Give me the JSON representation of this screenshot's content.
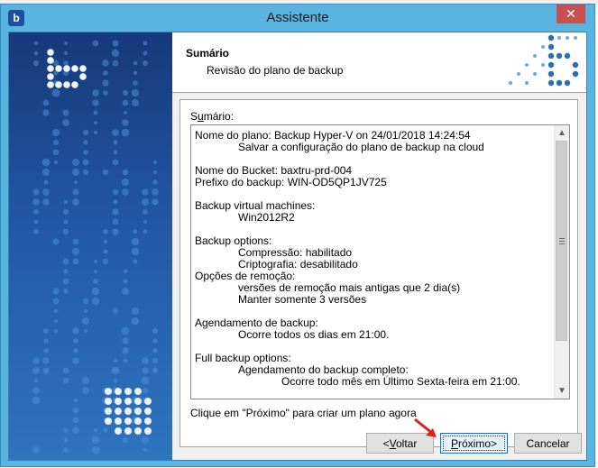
{
  "window": {
    "title": "Assistente",
    "icon": "app-logo-icon",
    "close_glyph": "✕"
  },
  "header": {
    "title": "Sumário",
    "subtitle": "Revisão do plano de backup"
  },
  "summary": {
    "label": "Sumário:",
    "lines": [
      {
        "text": "Nome do plano: Backup Hyper-V on 24/01/2018 14:24:54",
        "indent": 0
      },
      {
        "text": "Salvar a configuração do plano de backup na cloud",
        "indent": 1
      },
      {
        "text": "",
        "indent": 0
      },
      {
        "text": "Nome do Bucket: baxtru-prd-004",
        "indent": 0
      },
      {
        "text": "Prefixo do backup: WIN-OD5QP1JV725",
        "indent": 0
      },
      {
        "text": "",
        "indent": 0
      },
      {
        "text": "Backup virtual machines:",
        "indent": 0
      },
      {
        "text": "Win2012R2",
        "indent": 1
      },
      {
        "text": "",
        "indent": 0
      },
      {
        "text": "Backup options:",
        "indent": 0
      },
      {
        "text": "Compressão: habilitado",
        "indent": 1
      },
      {
        "text": "Criptografia: desabilitado",
        "indent": 1
      },
      {
        "text": "Opções de remoção:",
        "indent": 0
      },
      {
        "text": "versões de remoção mais antigas que 2 dia(s)",
        "indent": 1
      },
      {
        "text": "Manter somente 3 versões",
        "indent": 1
      },
      {
        "text": "",
        "indent": 0
      },
      {
        "text": "Agendamento de backup:",
        "indent": 0
      },
      {
        "text": "Ocorre todos os dias em 21:00.",
        "indent": 1
      },
      {
        "text": "",
        "indent": 0
      },
      {
        "text": "Full backup options:",
        "indent": 0
      },
      {
        "text": "Agendamento do backup completo:",
        "indent": 1
      },
      {
        "text": "Ocorre todo mês em Último Sexta-feira em 21:00.",
        "indent": 2
      }
    ]
  },
  "hint": "Clique em \"Próximo\" para criar um plano agora",
  "buttons": {
    "back": "<Voltar",
    "next": "Próximo>",
    "cancel": "Cancelar"
  },
  "colors": {
    "titlebar": "#5ab4e0",
    "close": "#c75050",
    "banner_top": "#16397a",
    "banner_bottom": "#2e74bf",
    "annotation_arrow": "#e02020"
  }
}
